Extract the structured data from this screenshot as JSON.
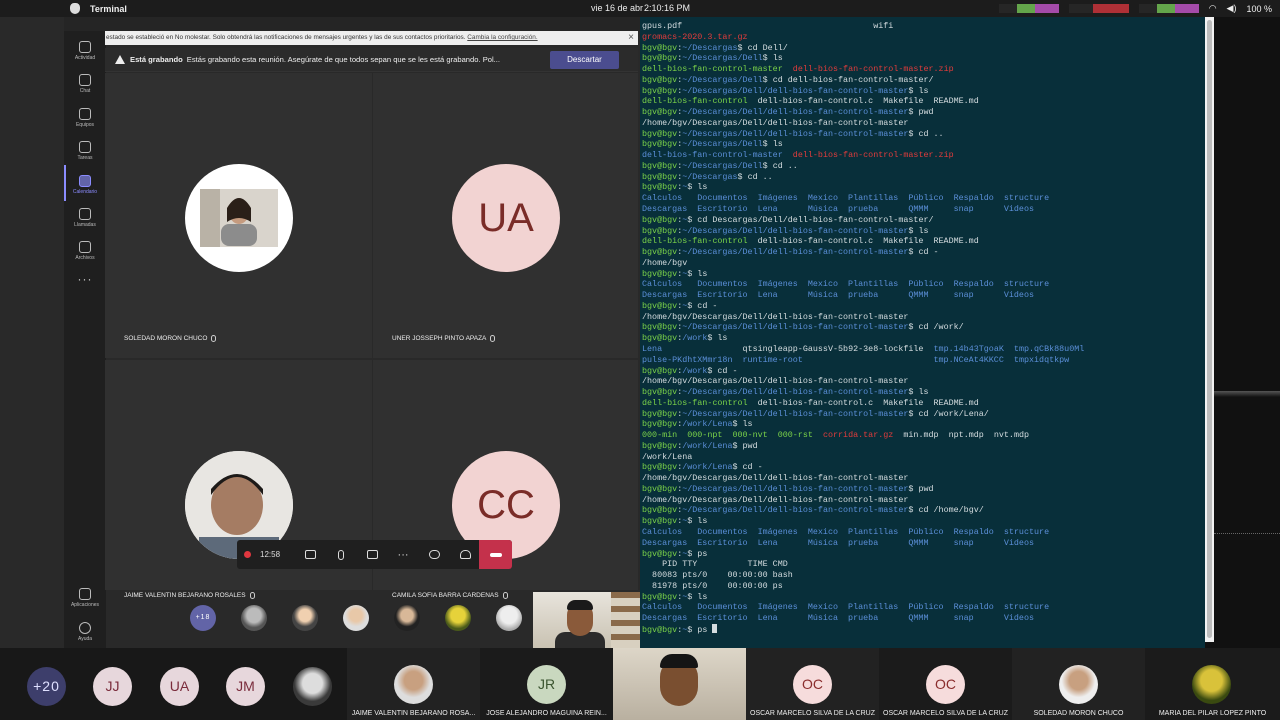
{
  "menubar": {
    "app_name": "Terminal",
    "date": "vie 16 de abr",
    "clock": "2:10:16 PM",
    "battery": "100 %"
  },
  "teams": {
    "rail": [
      {
        "label": "Actividad",
        "icon": "bell-icon"
      },
      {
        "label": "Chat",
        "icon": "chat-icon"
      },
      {
        "label": "Equipos",
        "icon": "teams-icon"
      },
      {
        "label": "Tareas",
        "icon": "tasks-icon"
      },
      {
        "label": "Calendario",
        "icon": "calendar-icon"
      },
      {
        "label": "Llamadas",
        "icon": "phone-icon"
      },
      {
        "label": "Archivos",
        "icon": "files-icon"
      },
      {
        "label": "···",
        "icon": "more-icon"
      },
      {
        "label": "Aplicaciones",
        "icon": "apps-icon"
      },
      {
        "label": "Ayuda",
        "icon": "help-icon"
      }
    ],
    "notice_text": "estado se estableció en No molestar. Solo obtendrá las notificaciones de mensajes urgentes y las de sus contactos prioritarios.",
    "notice_link": "Cambia la configuración.",
    "recording_title": "Está grabando",
    "recording_text": "Estás grabando esta reunión. Asegúrate de que todos sepan que se les está grabando. Pol...",
    "discard_button": "Descartar",
    "tiles": [
      {
        "name": "SOLEDAD MORON CHUCO",
        "initials": ""
      },
      {
        "name": "UNER JOSSEPH PINTO APAZA",
        "initials": "UA"
      },
      {
        "name": "JAIME VALENTIN BEJARANO ROSALES",
        "initials": ""
      },
      {
        "name": "CAMILA SOFIA BARRA CARDENAS",
        "initials": "CC"
      }
    ],
    "call_timer": "12:58",
    "more_participants": "+18"
  },
  "terminal": {
    "lines": [
      [
        [
          "wh",
          "gpus.pdf                                      wifi"
        ]
      ],
      [
        [
          "rd",
          "gromacs-2020.3.tar.gz"
        ]
      ],
      [
        [
          "g1",
          "bgv@bgv"
        ],
        [
          "wh",
          ":"
        ],
        [
          "bl",
          "~/Descargas"
        ],
        [
          "wh",
          "$ cd Dell/"
        ]
      ],
      [
        [
          "g1",
          "bgv@bgv"
        ],
        [
          "wh",
          ":"
        ],
        [
          "bl",
          "~/Descargas/Dell"
        ],
        [
          "wh",
          "$ ls"
        ]
      ],
      [
        [
          "g1",
          "dell-bios-fan-control-master"
        ],
        [
          "wh",
          "  "
        ],
        [
          "rd",
          "dell-bios-fan-control-master.zip"
        ]
      ],
      [
        [
          "g1",
          "bgv@bgv"
        ],
        [
          "wh",
          ":"
        ],
        [
          "bl",
          "~/Descargas/Dell"
        ],
        [
          "wh",
          "$ cd dell-bios-fan-control-master/"
        ]
      ],
      [
        [
          "g1",
          "bgv@bgv"
        ],
        [
          "wh",
          ":"
        ],
        [
          "bl",
          "~/Descargas/Dell/dell-bios-fan-control-master"
        ],
        [
          "wh",
          "$ ls"
        ]
      ],
      [
        [
          "g1",
          "dell-bios-fan-control"
        ],
        [
          "wh",
          "  dell-bios-fan-control.c  Makefile  README.md"
        ]
      ],
      [
        [
          "g1",
          "bgv@bgv"
        ],
        [
          "wh",
          ":"
        ],
        [
          "bl",
          "~/Descargas/Dell/dell-bios-fan-control-master"
        ],
        [
          "wh",
          "$ pwd"
        ]
      ],
      [
        [
          "wh",
          "/home/bgv/Descargas/Dell/dell-bios-fan-control-master"
        ]
      ],
      [
        [
          "g1",
          "bgv@bgv"
        ],
        [
          "wh",
          ":"
        ],
        [
          "bl",
          "~/Descargas/Dell/dell-bios-fan-control-master"
        ],
        [
          "wh",
          "$ cd .."
        ]
      ],
      [
        [
          "g1",
          "bgv@bgv"
        ],
        [
          "wh",
          ":"
        ],
        [
          "bl",
          "~/Descargas/Dell"
        ],
        [
          "wh",
          "$ ls"
        ]
      ],
      [
        [
          "bl",
          "dell-bios-fan-control-master"
        ],
        [
          "wh",
          "  "
        ],
        [
          "rd",
          "dell-bios-fan-control-master.zip"
        ]
      ],
      [
        [
          "g1",
          "bgv@bgv"
        ],
        [
          "wh",
          ":"
        ],
        [
          "bl",
          "~/Descargas/Dell"
        ],
        [
          "wh",
          "$ cd .."
        ]
      ],
      [
        [
          "g1",
          "bgv@bgv"
        ],
        [
          "wh",
          ":"
        ],
        [
          "bl",
          "~/Descargas"
        ],
        [
          "wh",
          "$ cd .."
        ]
      ],
      [
        [
          "g1",
          "bgv@bgv"
        ],
        [
          "wh",
          ":"
        ],
        [
          "bl",
          "~"
        ],
        [
          "wh",
          "$ ls"
        ]
      ],
      [
        [
          "bl",
          "Calculos   Documentos  Imágenes  Mexico  Plantillas  Público  Respaldo  structure"
        ]
      ],
      [
        [
          "bl",
          "Descargas  Escritorio  Lena      Música  prueba      QMMM     snap      Videos"
        ]
      ],
      [
        [
          "g1",
          "bgv@bgv"
        ],
        [
          "wh",
          ":"
        ],
        [
          "bl",
          "~"
        ],
        [
          "wh",
          "$ cd Descargas/Dell/dell-bios-fan-control-master/"
        ]
      ],
      [
        [
          "g1",
          "bgv@bgv"
        ],
        [
          "wh",
          ":"
        ],
        [
          "bl",
          "~/Descargas/Dell/dell-bios-fan-control-master"
        ],
        [
          "wh",
          "$ ls"
        ]
      ],
      [
        [
          "g1",
          "dell-bios-fan-control"
        ],
        [
          "wh",
          "  dell-bios-fan-control.c  Makefile  README.md"
        ]
      ],
      [
        [
          "g1",
          "bgv@bgv"
        ],
        [
          "wh",
          ":"
        ],
        [
          "bl",
          "~/Descargas/Dell/dell-bios-fan-control-master"
        ],
        [
          "wh",
          "$ cd -"
        ]
      ],
      [
        [
          "wh",
          "/home/bgv"
        ]
      ],
      [
        [
          "g1",
          "bgv@bgv"
        ],
        [
          "wh",
          ":"
        ],
        [
          "bl",
          "~"
        ],
        [
          "wh",
          "$ ls"
        ]
      ],
      [
        [
          "bl",
          "Calculos   Documentos  Imágenes  Mexico  Plantillas  Público  Respaldo  structure"
        ]
      ],
      [
        [
          "bl",
          "Descargas  Escritorio  Lena      Música  prueba      QMMM     snap      Videos"
        ]
      ],
      [
        [
          "g1",
          "bgv@bgv"
        ],
        [
          "wh",
          ":"
        ],
        [
          "bl",
          "~"
        ],
        [
          "wh",
          "$ cd -"
        ]
      ],
      [
        [
          "wh",
          "/home/bgv/Descargas/Dell/dell-bios-fan-control-master"
        ]
      ],
      [
        [
          "g1",
          "bgv@bgv"
        ],
        [
          "wh",
          ":"
        ],
        [
          "bl",
          "~/Descargas/Dell/dell-bios-fan-control-master"
        ],
        [
          "wh",
          "$ cd /work/"
        ]
      ],
      [
        [
          "g1",
          "bgv@bgv"
        ],
        [
          "wh",
          ":"
        ],
        [
          "bl",
          "/work"
        ],
        [
          "wh",
          "$ ls"
        ]
      ],
      [
        [
          "bl",
          "Lena"
        ],
        [
          "wh",
          "                qtsingleapp-GaussV-5b92-3e8-lockfile  "
        ],
        [
          "bl",
          "tmp.14b43TgoaK  tmp.qCBk88u0Ml"
        ]
      ],
      [
        [
          "bl",
          "pulse-PKdhtXMmr18n  runtime-root"
        ],
        [
          "wh",
          "                          "
        ],
        [
          "bl",
          "tmp.NCeAt4KKCC  tmpxidqtkpw"
        ]
      ],
      [
        [
          "g1",
          "bgv@bgv"
        ],
        [
          "wh",
          ":"
        ],
        [
          "bl",
          "/work"
        ],
        [
          "wh",
          "$ cd -"
        ]
      ],
      [
        [
          "wh",
          "/home/bgv/Descargas/Dell/dell-bios-fan-control-master"
        ]
      ],
      [
        [
          "g1",
          "bgv@bgv"
        ],
        [
          "wh",
          ":"
        ],
        [
          "bl",
          "~/Descargas/Dell/dell-bios-fan-control-master"
        ],
        [
          "wh",
          "$ ls"
        ]
      ],
      [
        [
          "g1",
          "dell-bios-fan-control"
        ],
        [
          "wh",
          "  dell-bios-fan-control.c  Makefile  README.md"
        ]
      ],
      [
        [
          "g1",
          "bgv@bgv"
        ],
        [
          "wh",
          ":"
        ],
        [
          "bl",
          "~/Descargas/Dell/dell-bios-fan-control-master"
        ],
        [
          "wh",
          "$ cd /work/Lena/"
        ]
      ],
      [
        [
          "g1",
          "bgv@bgv"
        ],
        [
          "wh",
          ":"
        ],
        [
          "bl",
          "/work/Lena"
        ],
        [
          "wh",
          "$ ls"
        ]
      ],
      [
        [
          "g1",
          "000-min  000-npt  000-nvt  000-rst"
        ],
        [
          "wh",
          "  "
        ],
        [
          "rd",
          "corrida.tar.gz"
        ],
        [
          "wh",
          "  min.mdp  npt.mdp  nvt.mdp"
        ]
      ],
      [
        [
          "g1",
          "bgv@bgv"
        ],
        [
          "wh",
          ":"
        ],
        [
          "bl",
          "/work/Lena"
        ],
        [
          "wh",
          "$ pwd"
        ]
      ],
      [
        [
          "wh",
          "/work/Lena"
        ]
      ],
      [
        [
          "g1",
          "bgv@bgv"
        ],
        [
          "wh",
          ":"
        ],
        [
          "bl",
          "/work/Lena"
        ],
        [
          "wh",
          "$ cd -"
        ]
      ],
      [
        [
          "wh",
          "/home/bgv/Descargas/Dell/dell-bios-fan-control-master"
        ]
      ],
      [
        [
          "g1",
          "bgv@bgv"
        ],
        [
          "wh",
          ":"
        ],
        [
          "bl",
          "~/Descargas/Dell/dell-bios-fan-control-master"
        ],
        [
          "wh",
          "$ pwd"
        ]
      ],
      [
        [
          "wh",
          "/home/bgv/Descargas/Dell/dell-bios-fan-control-master"
        ]
      ],
      [
        [
          "g1",
          "bgv@bgv"
        ],
        [
          "wh",
          ":"
        ],
        [
          "bl",
          "~/Descargas/Dell/dell-bios-fan-control-master"
        ],
        [
          "wh",
          "$ cd /home/bgv/"
        ]
      ],
      [
        [
          "g1",
          "bgv@bgv"
        ],
        [
          "wh",
          ":"
        ],
        [
          "bl",
          "~"
        ],
        [
          "wh",
          "$ ls"
        ]
      ],
      [
        [
          "bl",
          "Calculos   Documentos  Imágenes  Mexico  Plantillas  Público  Respaldo  structure"
        ]
      ],
      [
        [
          "bl",
          "Descargas  Escritorio  Lena      Música  prueba      QMMM     snap      Videos"
        ]
      ],
      [
        [
          "g1",
          "bgv@bgv"
        ],
        [
          "wh",
          ":"
        ],
        [
          "bl",
          "~"
        ],
        [
          "wh",
          "$ ps"
        ]
      ],
      [
        [
          "wh",
          "    PID TTY          TIME CMD"
        ]
      ],
      [
        [
          "wh",
          "  80083 pts/0    00:00:00 bash"
        ]
      ],
      [
        [
          "wh",
          "  81978 pts/0    00:00:00 ps"
        ]
      ],
      [
        [
          "g1",
          "bgv@bgv"
        ],
        [
          "wh",
          ":"
        ],
        [
          "bl",
          "~"
        ],
        [
          "wh",
          "$ ls"
        ]
      ],
      [
        [
          "bl",
          "Calculos   Documentos  Imágenes  Mexico  Plantillas  Público  Respaldo  structure"
        ]
      ],
      [
        [
          "bl",
          "Descargas  Escritorio  Lena      Música  prueba      QMMM     snap      Videos"
        ]
      ],
      [
        [
          "g1",
          "bgv@bgv"
        ],
        [
          "wh",
          ":"
        ],
        [
          "bl",
          "~"
        ],
        [
          "wh",
          "$ ps "
        ]
      ]
    ]
  },
  "bottom_strip": {
    "chips": [
      {
        "text": "+20"
      },
      {
        "text": "JJ"
      },
      {
        "text": "UA"
      },
      {
        "text": "JM"
      },
      {
        "text": ""
      }
    ],
    "cells": [
      {
        "name": "JAIME VALENTIN BEJARANO ROSA...",
        "initials": ""
      },
      {
        "name": "JOSE ALEJANDRO MAGUIÑA REIN...",
        "initials": "JR"
      },
      {
        "name": "",
        "initials": ""
      },
      {
        "name": "OSCAR MARCELO SILVA DE LA CRUZ",
        "initials": "OC"
      },
      {
        "name": "OSCAR MARCELO SILVA DE LA CRUZ",
        "initials": "OC"
      },
      {
        "name": "SOLEDAD MORON CHUCO",
        "initials": ""
      },
      {
        "name": "MARIA DEL PILAR LOPEZ PINTO",
        "initials": ""
      }
    ]
  }
}
